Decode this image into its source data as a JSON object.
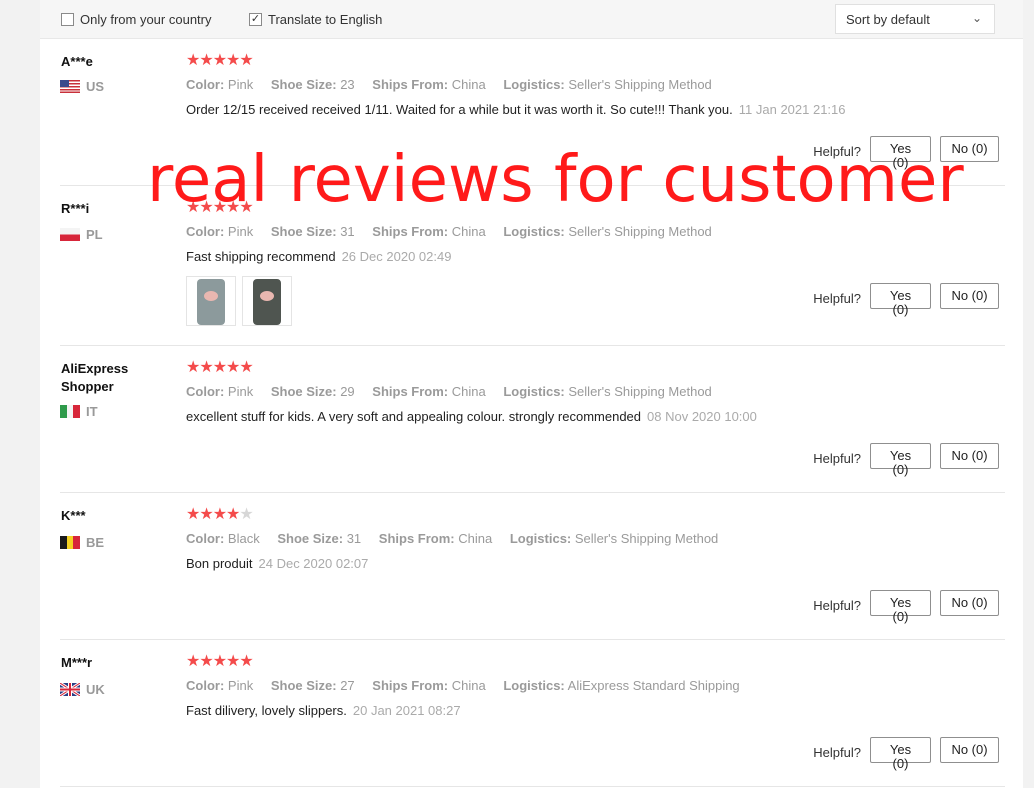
{
  "filters": {
    "only_country_label": "Only from your country",
    "only_country_checked": false,
    "translate_label": "Translate to English",
    "translate_checked": true,
    "sort_label": "Sort by default"
  },
  "labels": {
    "color": "Color:",
    "shoe_size": "Shoe Size:",
    "ships_from": "Ships From:",
    "logistics": "Logistics:",
    "helpful": "Helpful?"
  },
  "watermark_text": "real reviews for customer",
  "colors": {
    "star": "#f44b4b",
    "star_off": "#d7d7d7",
    "watermark": "#ff1a1a"
  },
  "reviews": [
    {
      "user": "A***e",
      "country": "US",
      "flag": "us-flag-icon",
      "stars": 5,
      "color": "Pink",
      "shoe_size": "23",
      "ships_from": "China",
      "logistics": "Seller's Shipping Method",
      "text": "Order 12/15 received received 1/11. Waited for a while but it was worth it. So cute!!! Thank you.",
      "date": "11 Jan 2021 21:16",
      "yes": "Yes (0)",
      "no": "No (0)"
    },
    {
      "user": "R***i",
      "country": "PL",
      "flag": "pl-flag-icon",
      "stars": 5,
      "color": "Pink",
      "shoe_size": "31",
      "ships_from": "China",
      "logistics": "Seller's Shipping Method",
      "text": "Fast shipping recommend",
      "date": "26 Dec 2020 02:49",
      "photos": [
        "slipper-photo-1",
        "slipper-photo-2"
      ],
      "yes": "Yes (0)",
      "no": "No (0)"
    },
    {
      "user": "AliExpress Shopper",
      "country": "IT",
      "flag": "it-flag-icon",
      "stars": 5,
      "color": "Pink",
      "shoe_size": "29",
      "ships_from": "China",
      "logistics": "Seller's Shipping Method",
      "text": "excellent stuff for kids. A very soft and appealing colour. strongly recommended",
      "date": "08 Nov 2020 10:00",
      "yes": "Yes (0)",
      "no": "No (0)"
    },
    {
      "user": "K***",
      "country": "BE",
      "flag": "be-flag-icon",
      "stars": 4,
      "color": "Black",
      "shoe_size": "31",
      "ships_from": "China",
      "logistics": "Seller's Shipping Method",
      "text": "Bon produit",
      "date": "24 Dec 2020 02:07",
      "yes": "Yes (0)",
      "no": "No (0)"
    },
    {
      "user": "M***r",
      "country": "UK",
      "flag": "uk-flag-icon",
      "stars": 5,
      "color": "Pink",
      "shoe_size": "27",
      "ships_from": "China",
      "logistics": "AliExpress Standard Shipping",
      "text": "Fast dilivery, lovely slippers.",
      "date": "20 Jan 2021 08:27",
      "yes": "Yes (0)",
      "no": "No (0)"
    }
  ]
}
